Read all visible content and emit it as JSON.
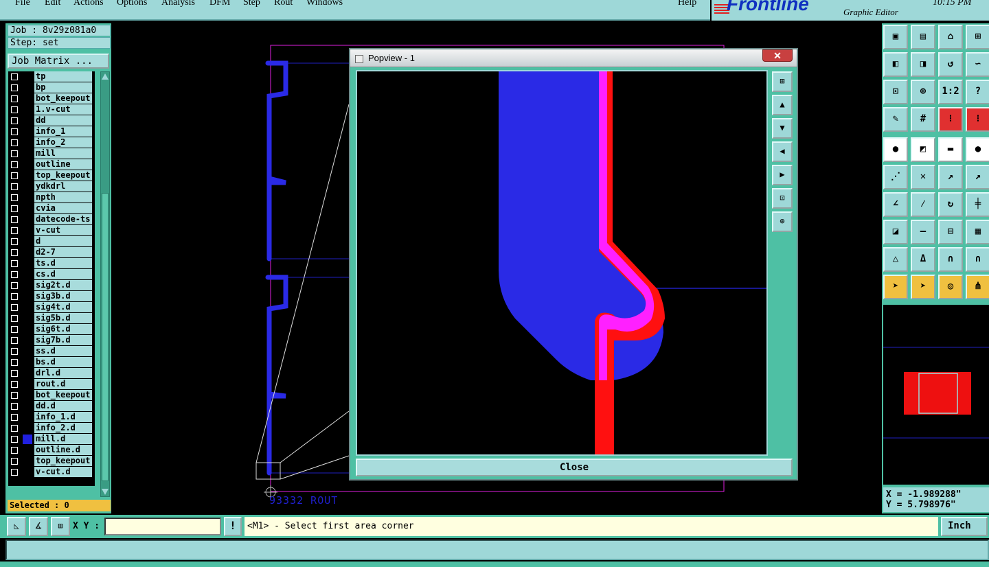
{
  "menu": {
    "items": [
      "File",
      "Edit",
      "Actions",
      "Options",
      "Analysis",
      "DFM",
      "Step",
      "Rout",
      "Windows"
    ],
    "help": "Help"
  },
  "logo": {
    "brand": "Frontline",
    "subtitle": "Graphic Editor",
    "time": "10:15 PM"
  },
  "job": {
    "label": "Job : 8v29z081a0",
    "step": "Step: set",
    "matrix_button": "Job Matrix ..."
  },
  "layers": [
    {
      "name": "tp",
      "color": "#000000"
    },
    {
      "name": "bp",
      "color": "#000000"
    },
    {
      "name": "bot_keepout",
      "color": "#000000"
    },
    {
      "name": "1.v-cut",
      "color": "#000000"
    },
    {
      "name": "dd",
      "color": "#000000"
    },
    {
      "name": "info_1",
      "color": "#000000"
    },
    {
      "name": "info_2",
      "color": "#000000"
    },
    {
      "name": "mill",
      "color": "#000000"
    },
    {
      "name": "outline",
      "color": "#000000"
    },
    {
      "name": "top_keepout",
      "color": "#000000"
    },
    {
      "name": "ydkdrl",
      "color": "#000000"
    },
    {
      "name": "npth",
      "color": "#000000"
    },
    {
      "name": "cvia",
      "color": "#000000"
    },
    {
      "name": "datecode-ts",
      "color": "#000000"
    },
    {
      "name": "v-cut",
      "color": "#000000"
    },
    {
      "name": "d",
      "color": "#000000"
    },
    {
      "name": "d2-7",
      "color": "#000000"
    },
    {
      "name": "ts.d",
      "color": "#000000"
    },
    {
      "name": "cs.d",
      "color": "#000000"
    },
    {
      "name": "sig2t.d",
      "color": "#000000"
    },
    {
      "name": "sig3b.d",
      "color": "#000000"
    },
    {
      "name": "sig4t.d",
      "color": "#000000"
    },
    {
      "name": "sig5b.d",
      "color": "#000000"
    },
    {
      "name": "sig6t.d",
      "color": "#000000"
    },
    {
      "name": "sig7b.d",
      "color": "#000000"
    },
    {
      "name": "ss.d",
      "color": "#000000"
    },
    {
      "name": "bs.d",
      "color": "#000000"
    },
    {
      "name": "drl.d",
      "color": "#000000"
    },
    {
      "name": "rout.d",
      "color": "#000000"
    },
    {
      "name": "bot_keepout",
      "color": "#000000"
    },
    {
      "name": "dd.d",
      "color": "#000000"
    },
    {
      "name": "info_1.d",
      "color": "#000000"
    },
    {
      "name": "info_2.d",
      "color": "#000000"
    },
    {
      "name": "mill.d",
      "color": "#2020e0"
    },
    {
      "name": "outline.d",
      "color": "#000000"
    },
    {
      "name": "top_keepout",
      "color": "#000000"
    },
    {
      "name": "v-cut.d",
      "color": "#000000"
    }
  ],
  "selected": "Selected : 0",
  "popview": {
    "title": "Popview - 1",
    "close_label": "Close",
    "close_x": "✕"
  },
  "canvas": {
    "label": "93332  ROUT"
  },
  "coords": {
    "x": "X = -1.989288\"",
    "y": "Y = 5.798976\""
  },
  "bottom": {
    "xy_label": "X Y :",
    "xy_value": "",
    "info_btn": "!",
    "prompt": "<M1> - Select first area corner",
    "unit": "Inch"
  },
  "colors": {
    "panel": "#4ec0a4",
    "light": "#9ed8d8",
    "trace_blue": "#2a2ae6",
    "trace_red": "#ff1010",
    "trace_magenta": "#ff20ff"
  }
}
